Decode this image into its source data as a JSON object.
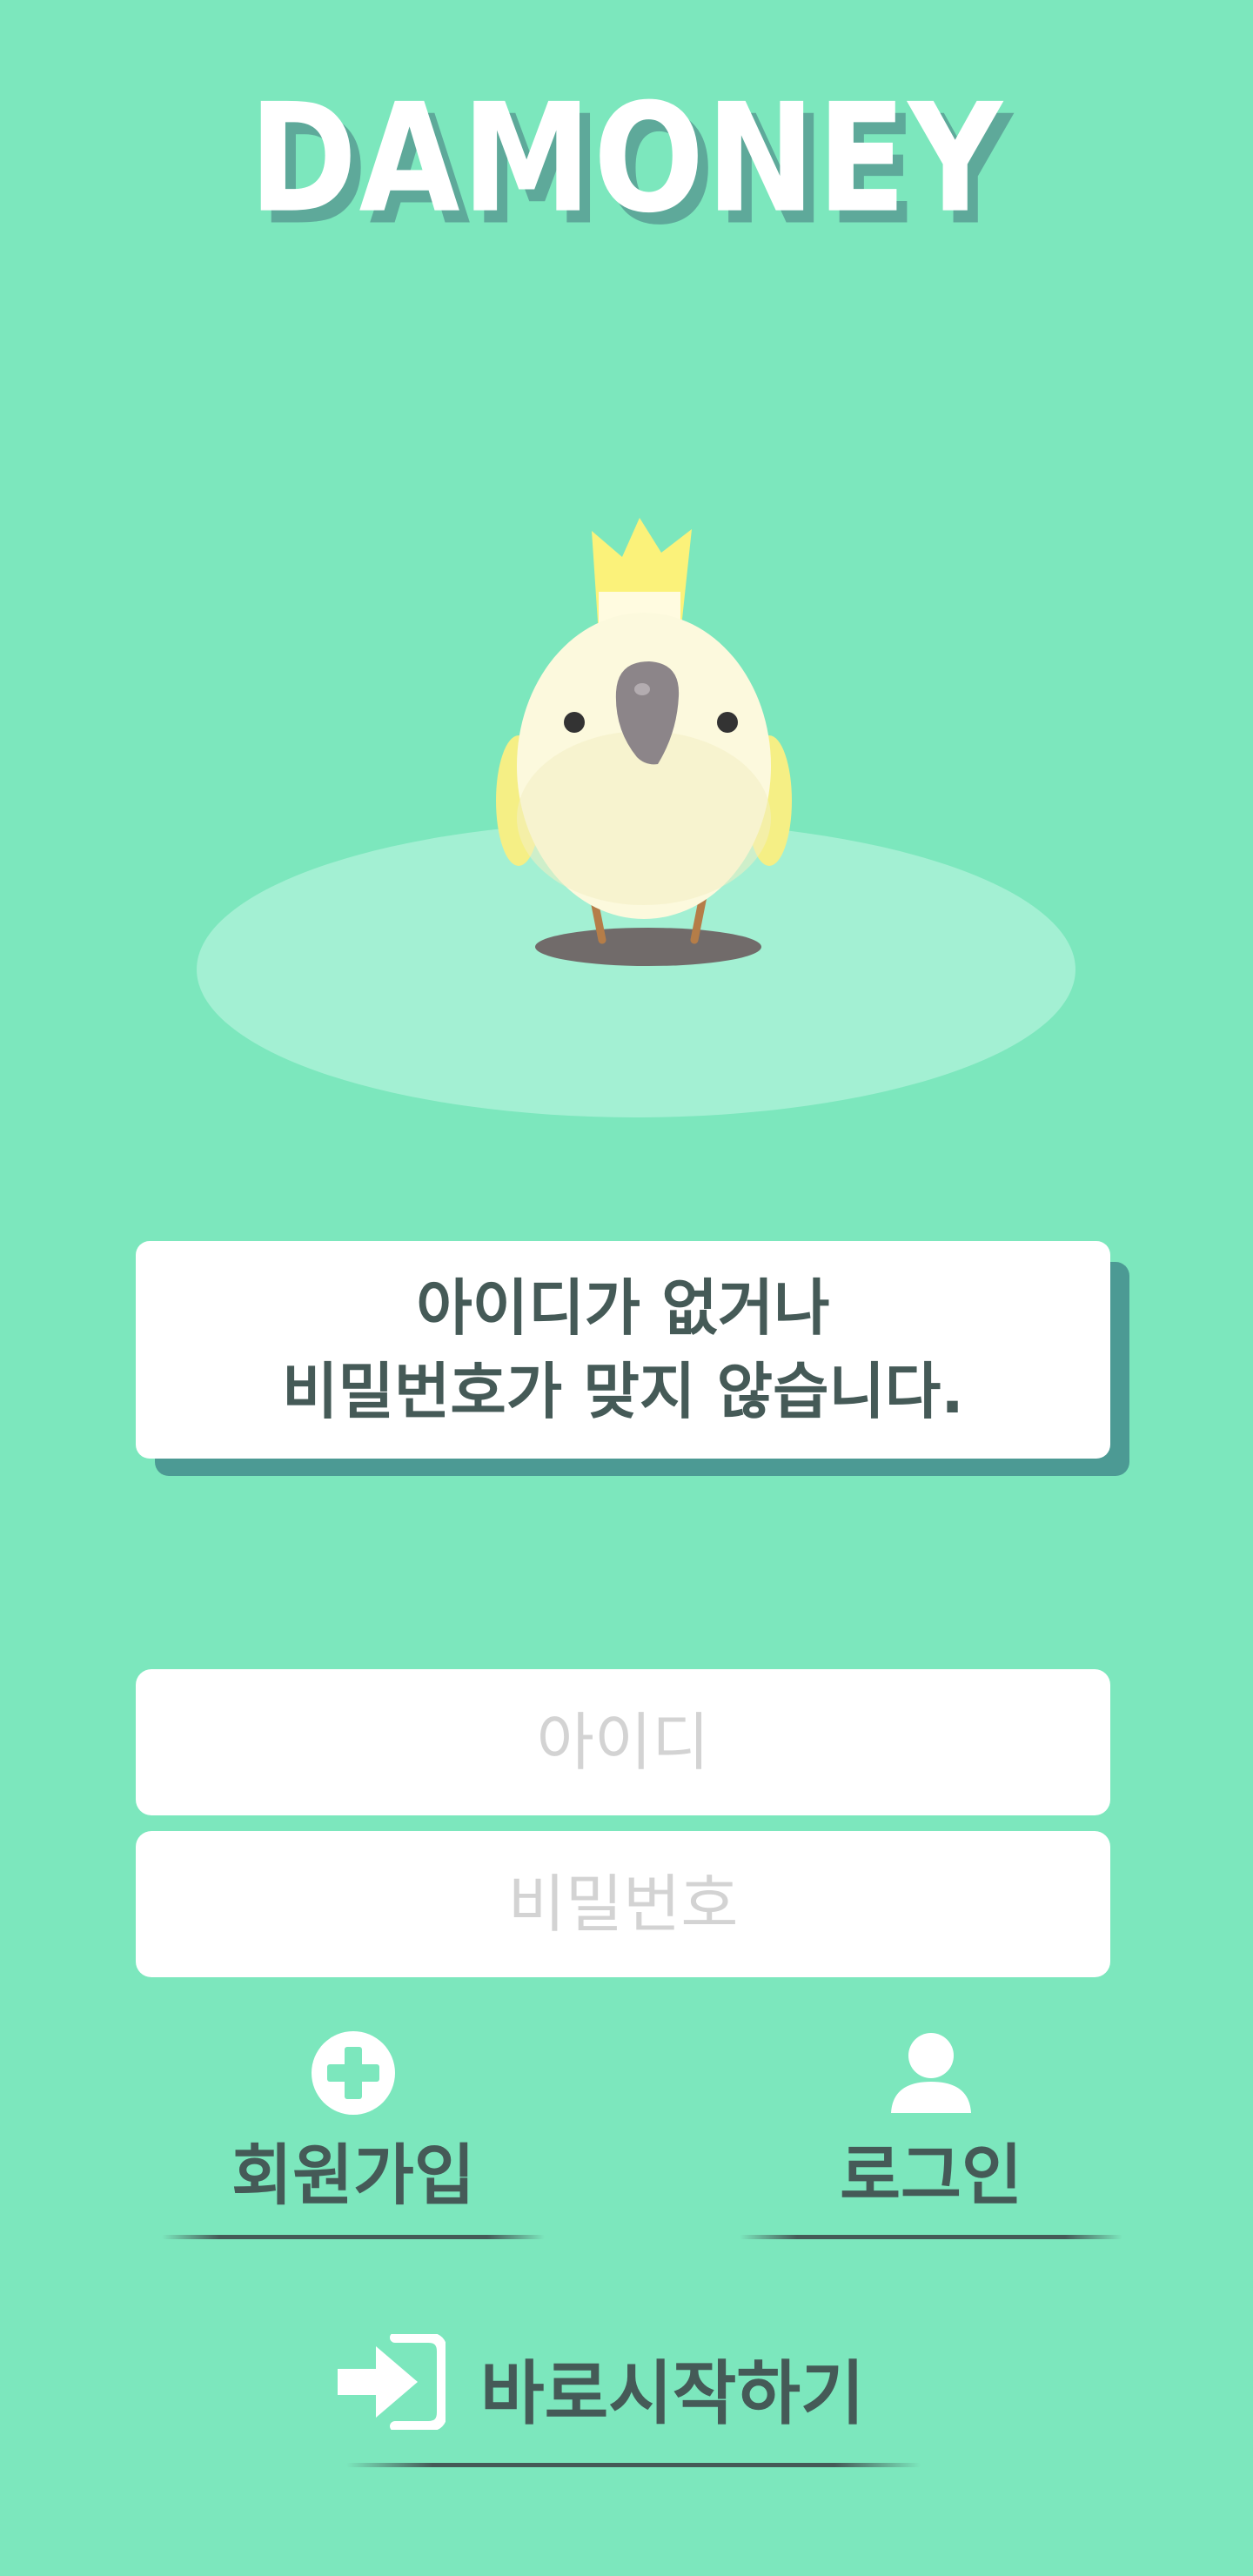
{
  "brand": {
    "logo_text": "DAMONEY"
  },
  "alert": {
    "line1": "아이디가 없거나",
    "line2": "비밀번호가 맞지 않습니다."
  },
  "form": {
    "id_placeholder": "아이디",
    "password_placeholder": "비밀번호"
  },
  "actions": {
    "signup_label": "회원가입",
    "login_label": "로그인",
    "quick_start_label": "바로시작하기"
  },
  "icons": {
    "signup": "plus-circle-icon",
    "login": "user-icon",
    "quick_start": "enter-arrow-icon",
    "mascot": "cockatoo-mascot"
  },
  "colors": {
    "background": "#7ce7bd",
    "text": "#455a57",
    "accent_shadow": "#4c9a94"
  }
}
